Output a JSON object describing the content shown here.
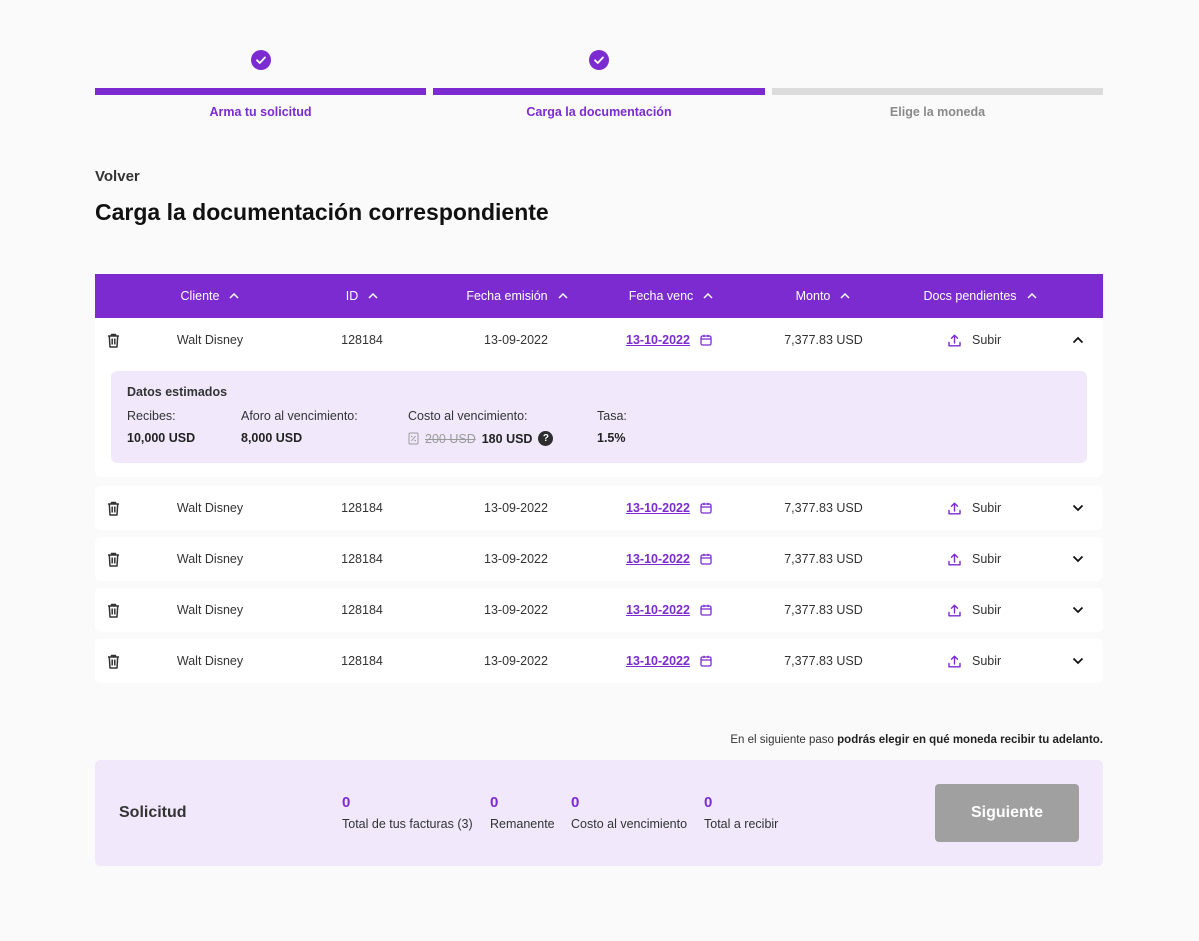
{
  "stepper": [
    {
      "label": "Arma tu solicitud",
      "done": true
    },
    {
      "label": "Carga la documentación",
      "done": true
    },
    {
      "label": "Elige la moneda",
      "done": false
    }
  ],
  "back_label": "Volver",
  "page_title": "Carga la documentación correspondiente",
  "table": {
    "headers": [
      "Cliente",
      "ID",
      "Fecha emisión",
      "Fecha venc",
      "Monto",
      "Docs pendientes"
    ],
    "rows": [
      {
        "cliente": "Walt Disney",
        "id": "128184",
        "emision": "13-09-2022",
        "vencimiento": "13-10-2022",
        "monto": "7,377.83 USD",
        "docs": "Subir",
        "expanded": true
      },
      {
        "cliente": "Walt Disney",
        "id": "128184",
        "emision": "13-09-2022",
        "vencimiento": "13-10-2022",
        "monto": "7,377.83 USD",
        "docs": "Subir",
        "expanded": false
      },
      {
        "cliente": "Walt Disney",
        "id": "128184",
        "emision": "13-09-2022",
        "vencimiento": "13-10-2022",
        "monto": "7,377.83 USD",
        "docs": "Subir",
        "expanded": false
      },
      {
        "cliente": "Walt Disney",
        "id": "128184",
        "emision": "13-09-2022",
        "vencimiento": "13-10-2022",
        "monto": "7,377.83 USD",
        "docs": "Subir",
        "expanded": false
      },
      {
        "cliente": "Walt Disney",
        "id": "128184",
        "emision": "13-09-2022",
        "vencimiento": "13-10-2022",
        "monto": "7,377.83 USD",
        "docs": "Subir",
        "expanded": false
      }
    ]
  },
  "detail": {
    "title": "Datos estimados",
    "recibes_label": "Recibes:",
    "recibes_value": "10,000 USD",
    "aforo_label": "Aforo al vencimiento:",
    "aforo_value": "8,000 USD",
    "costo_label": "Costo al vencimiento:",
    "costo_old": "200 USD",
    "costo_new": "180 USD",
    "help": "?",
    "tasa_label": "Tasa:",
    "tasa_value": "1.5%"
  },
  "note": {
    "prefix": "En el siguiente paso ",
    "bold": "podrás elegir en qué moneda recibir tu adelanto."
  },
  "summary": {
    "title": "Solicitud",
    "items": [
      {
        "value": "0",
        "label": "Total de tus facturas (3)"
      },
      {
        "value": "0",
        "label": "Remanente"
      },
      {
        "value": "0",
        "label": "Costo al vencimiento"
      },
      {
        "value": "0",
        "label": "Total a recibir"
      }
    ],
    "button": "Siguiente"
  },
  "colors": {
    "accent": "#7b2bd0",
    "light_accent": "#f1e8fc",
    "disabled": "#a0a0a0"
  }
}
